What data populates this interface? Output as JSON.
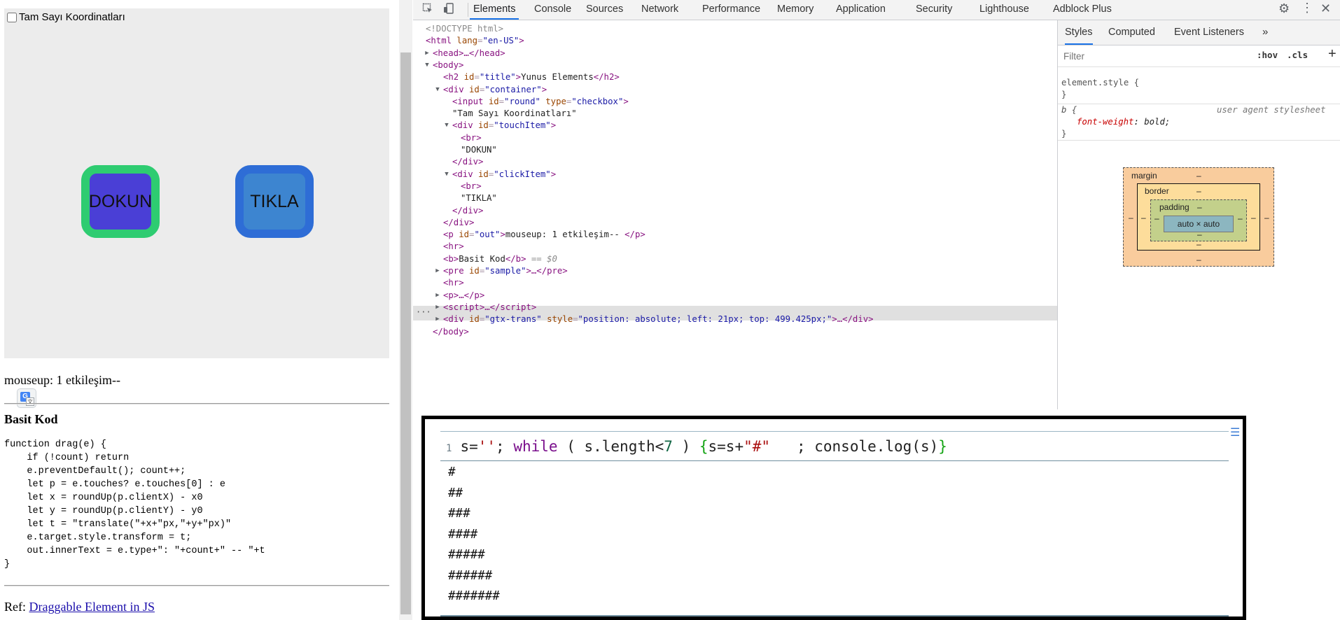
{
  "page": {
    "checkbox_label": "Tam Sayı Koordinatları",
    "touch_item": "DOKUN",
    "click_item": "TIKLA",
    "out_text": "mouseup: 1 etkileşim--",
    "heading": "Basit Kod",
    "code_lines": [
      "function drag(e) {",
      "    if (!count) return",
      "    e.preventDefault(); count++;",
      "    let p = e.touches? e.touches[0] : e",
      "    let x = roundUp(p.clientX) - x0",
      "    let y = roundUp(p.clientY) - y0",
      "    let t = \"translate(\"+x+\"px,\"+y+\"px)\"",
      "    e.target.style.transform = t;",
      "    out.innerText = e.type+\": \"+count+\" -- \"+t",
      "}"
    ],
    "ref_label": "Ref:",
    "ref_link": "Draggable Element in JS"
  },
  "devtools": {
    "tabs": [
      "Elements",
      "Console",
      "Sources",
      "Network",
      "Performance",
      "Memory",
      "Application",
      "Security",
      "Lighthouse",
      "Adblock Plus"
    ],
    "active_tab": "Elements",
    "dom": {
      "doctype": "<!DOCTYPE html>",
      "html_lang": "en-US",
      "head": "<head>…</head>",
      "h2_id": "title",
      "h2_text": "Yunus Elements",
      "container_id": "container",
      "input_id": "round",
      "input_type": "checkbox",
      "checkbox_text": "\"Tam Sayı Koordinatları\"",
      "touch_id": "touchItem",
      "touch_text": "\"DOKUN\"",
      "click_id": "clickItem",
      "click_text": "\"TIKLA\"",
      "p_id": "out",
      "p_text": "mouseup: 1 etkileşim-- ",
      "b_text": "Basit Kod",
      "selected_marker": "== $0",
      "pre_id": "sample",
      "gtx_id": "gtx-trans",
      "gtx_style": "position: absolute; left: 21px; top: 499.425px;"
    },
    "styles_tabs": [
      "Styles",
      "Computed",
      "Event Listeners"
    ],
    "filter_placeholder": "Filter",
    "hov": ":hov",
    "cls": ".cls",
    "element_style": "element.style {",
    "b_selector": "b {",
    "ua_label": "user agent stylesheet",
    "ua_prop": "font-weight",
    "ua_value": "bold;",
    "box_model": {
      "margin": "margin",
      "border": "border",
      "padding": "padding",
      "content": "auto × auto",
      "dash": "–"
    }
  },
  "code_panel": {
    "line_number": "1",
    "output": [
      "#",
      "##",
      "###",
      "####",
      "#####",
      "######",
      "#######"
    ]
  },
  "colors": {
    "touch_bg": "#4a3fd6",
    "touch_border": "#2ecc71",
    "click_bg": "#3d85d0",
    "click_border": "#2e6dd6",
    "accent": "#1a73e8"
  }
}
